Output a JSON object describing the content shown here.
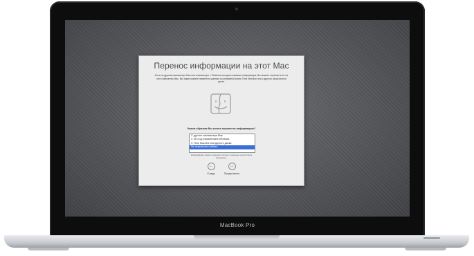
{
  "device": {
    "brand_label": "MacBook Pro"
  },
  "dialog": {
    "title": "Перенос информации на этот Mac",
    "description": "Если на другом компьютере Mac или компьютере с Windows находится важная информация, Вы можете перенести ее на этот компьютер Mac. Вы также можете перенести данные из резервной копии Time Machine или с другого загрузочного диска.",
    "icon": "finder-face-icon",
    "question": "Каким образом Вы хотите перенести информацию?",
    "options": [
      "С другого компьютера Mac",
      "С ПК под управлением Windows",
      "С Time Machine или другого диска",
      "Не переносить сейчас"
    ],
    "selected_option": "Не переносить сейчас",
    "note": "Информацию можно перенести позже с помощью «Ассистента миграции».",
    "back_label": "Сзади",
    "continue_label": "Продолжить"
  },
  "colors": {
    "selection": "#3a6fd8",
    "screen_background": "#55565a",
    "dialog_background": "#ececec"
  }
}
